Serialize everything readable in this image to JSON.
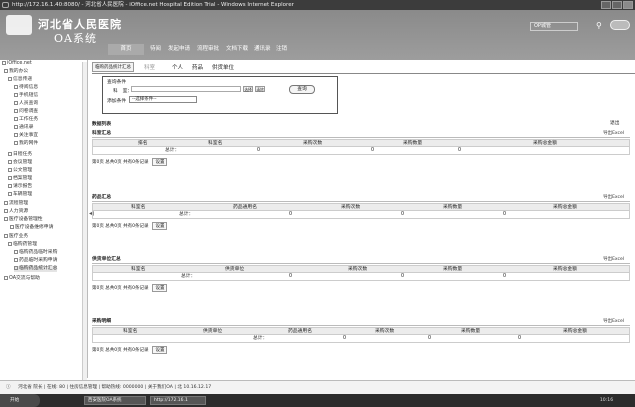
{
  "window": {
    "title": "http://172.16.1.40:8080/ - 河北省人民医院 - iOffice.net Hospital Edition Trial - Windows Internet Explorer"
  },
  "header": {
    "hospital_name": "河北省人民医院",
    "system_name": "OA系统",
    "user_field": "OP城管",
    "nav": [
      "首页",
      "待阅",
      "发起申请",
      "流程审批",
      "文档下载",
      "通讯录",
      "注销"
    ]
  },
  "sidebar": {
    "root": "iOffice.net",
    "items": [
      "我的办公",
      "信息传递",
      "待阅信息",
      "手机短信",
      "人员查询",
      "问卷调查",
      "工作任务",
      "通讯录",
      "关注事宜",
      "我的网件",
      "日程任务",
      "会议管理",
      "公文管理",
      "档案管理",
      "请示报告",
      "车辆管理",
      "流程管理",
      "人力资源",
      "医疗设备管理性",
      "医疗设备维修申请",
      "医疗业务",
      "临购药管理",
      "临购药品临时采购",
      "药品临时采购申请",
      "临购药品统计汇总",
      "OA交流与帮助"
    ]
  },
  "main": {
    "tabs": [
      "临购药品统计汇总",
      "科室",
      "个人",
      "药品",
      "供货单位"
    ],
    "query": {
      "legend": "查询条件",
      "dept_label": "科　室：",
      "select_btn": "选择",
      "clear_btn": "清除",
      "add_label": "添加条件",
      "add_option": "--选择条件--",
      "search_btn": "查询"
    },
    "data_list_label": "数据列表",
    "exit_btn": "退出",
    "export_label": "导出Excel",
    "pager_text": "第0页 总共0页 共有0条记录",
    "setting_btn": "设置",
    "total_label": "总计：",
    "zero": "0",
    "sections": [
      {
        "title": "科室汇总",
        "columns": [
          "排名",
          "科室名",
          "采购次数",
          "采购数量",
          "采购总金额"
        ]
      },
      {
        "title": "药品汇总",
        "columns": [
          "科室名",
          "药品通用名",
          "采购次数",
          "采购数量",
          "采购总金额"
        ]
      },
      {
        "title": "供货单位汇总",
        "columns": [
          "科室名",
          "供货单位",
          "采购次数",
          "采购数量",
          "采购总金额"
        ]
      },
      {
        "title": "采购明细",
        "columns": [
          "科室名",
          "供货单位",
          "药品通用名",
          "采购次数",
          "采购数量",
          "采购总金额"
        ]
      }
    ]
  },
  "statusbar": {
    "text": "河北省 院长 | 在线: 80 | 住房信息管理 | 帮助热线: 0000000 | 关于我们OA | 北 10.16.12.17"
  },
  "taskbar": {
    "start": "开始",
    "tasks": [
      "西安医院OA系统",
      "http://172.16.1"
    ],
    "clock": "10:16"
  },
  "colors": {
    "banner": "#9a9a9a",
    "titlebar": "#3c3c3c",
    "taskbar": "#2c2c2c"
  }
}
